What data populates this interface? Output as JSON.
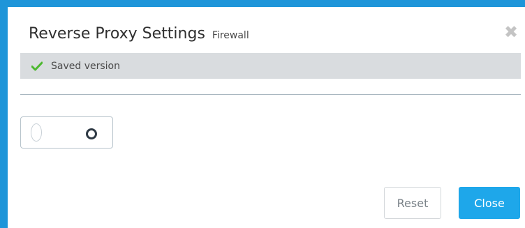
{
  "dialog": {
    "title": "Reverse Proxy Settings",
    "subtitle": "Firewall",
    "close_icon": "close-x-icon"
  },
  "status": {
    "icon": "checkmark-icon",
    "text": "Saved version",
    "icon_color": "#4cb82f"
  },
  "toggle": {
    "state": "off"
  },
  "actions": {
    "reset_label": "Reset",
    "close_label": "Close"
  },
  "colors": {
    "accent": "#1e95d9",
    "primary_button": "#1ea7ea"
  }
}
